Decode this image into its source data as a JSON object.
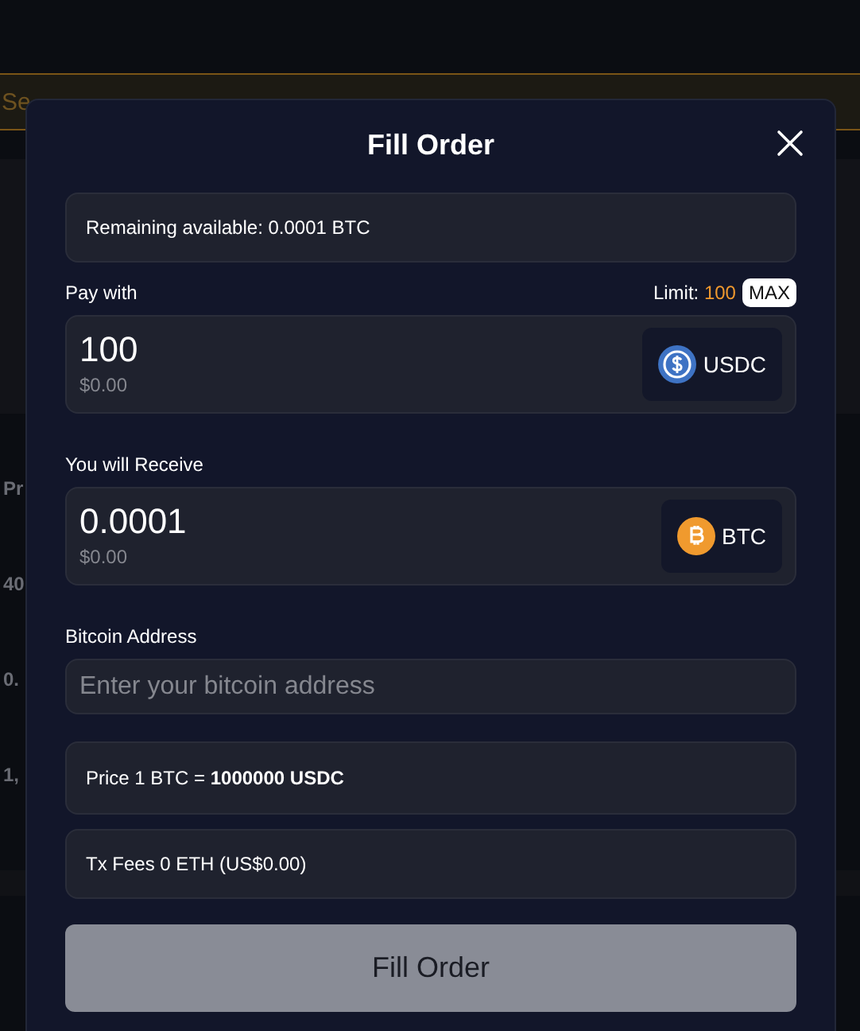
{
  "backdrop": [
    {
      "kind": "search",
      "text": "Se"
    },
    {
      "kind": "heading",
      "text": "Pr"
    },
    {
      "kind": "cell",
      "text": "40"
    },
    {
      "kind": "cell",
      "text": "0."
    },
    {
      "kind": "cell",
      "text": "1,"
    }
  ],
  "modal": {
    "title": "Fill Order",
    "remaining": "Remaining available: 0.0001 BTC",
    "pay": {
      "label": "Pay with",
      "limit_label": "Limit:",
      "limit_value": "100",
      "max": "MAX",
      "amount": "100",
      "usd": "$0.00",
      "token": {
        "symbol": "USDC",
        "kind": "usdc"
      }
    },
    "receive": {
      "label": "You will Receive",
      "amount": "0.0001",
      "usd": "$0.00",
      "token": {
        "symbol": "BTC",
        "kind": "btc"
      }
    },
    "address": {
      "label": "Bitcoin Address",
      "placeholder": "Enter your bitcoin address"
    },
    "price": "Price 1 BTC = **1000000 USDC**",
    "fees": "Tx Fees 0 ETH (US$0.00)",
    "submit": {
      "label": "Fill Order",
      "disabled": true
    }
  }
}
